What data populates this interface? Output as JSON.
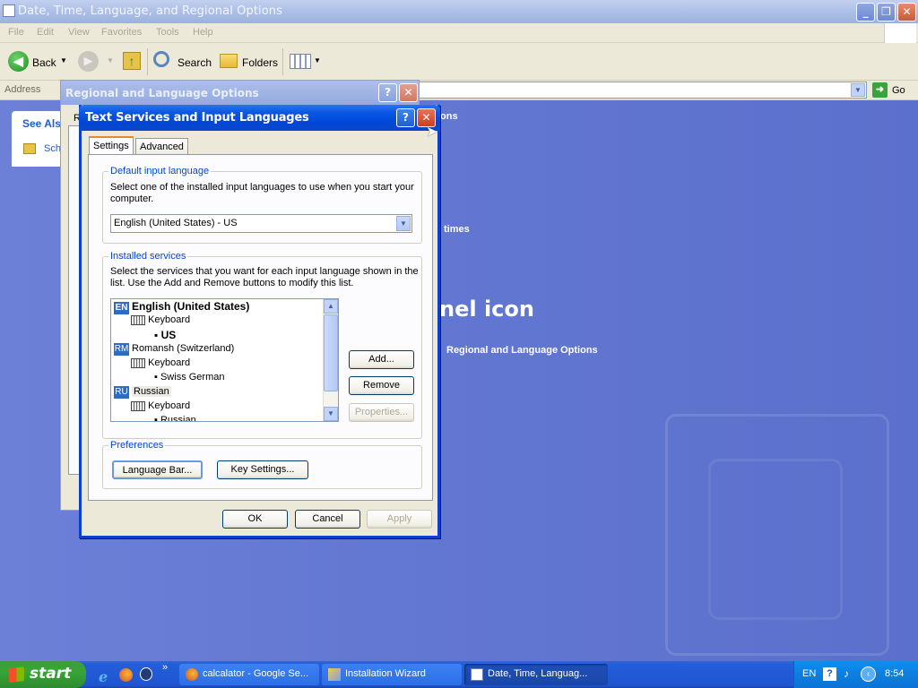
{
  "main_window": {
    "title": "Date, Time, Language, and Regional Options",
    "menu": [
      "File",
      "Edit",
      "View",
      "Favorites",
      "Tools",
      "Help"
    ],
    "toolbar": {
      "back": "Back",
      "search": "Search",
      "folders": "Folders"
    },
    "address_label": "Address",
    "go_label": "Go"
  },
  "panel_bg": {
    "see_also": "See Als",
    "sidebar_item": "Sch",
    "partial_options": "ons",
    "partial_times": "times",
    "partial_heading": "nel icon",
    "regional_link": "Regional and Language Options"
  },
  "regional_dialog": {
    "title": "Regional and Language Options",
    "tab_stub": "R"
  },
  "ts_dialog": {
    "title": "Text Services and Input Languages",
    "tabs": [
      "Settings",
      "Advanced"
    ],
    "default_group": {
      "legend": "Default input language",
      "desc": "Select one of the installed input languages to use when you start your computer.",
      "selected": "English (United States) - US"
    },
    "installed_group": {
      "legend": "Installed services",
      "desc": "Select the services that you want for each input language shown in the list. Use the Add and Remove buttons to modify this list.",
      "tree": [
        {
          "tag": "EN",
          "lang": "English (United States)",
          "kb": "Keyboard",
          "layout": "US"
        },
        {
          "tag": "RM",
          "lang": "Romansh (Switzerland)",
          "kb": "Keyboard",
          "layout": "Swiss German"
        },
        {
          "tag": "RU",
          "lang": "Russian",
          "kb": "Keyboard",
          "layout": "Russian"
        }
      ],
      "buttons": {
        "add": "Add...",
        "remove": "Remove",
        "properties": "Properties..."
      }
    },
    "prefs_group": {
      "legend": "Preferences",
      "language_bar": "Language Bar...",
      "key_settings": "Key Settings..."
    },
    "footer": {
      "ok": "OK",
      "cancel": "Cancel",
      "apply": "Apply"
    }
  },
  "taskbar": {
    "start": "start",
    "tasks": [
      "calcalator - Google Se...",
      "Installation Wizard",
      "Date, Time, Languag..."
    ],
    "tray_lang": "EN",
    "clock": "8:54"
  }
}
